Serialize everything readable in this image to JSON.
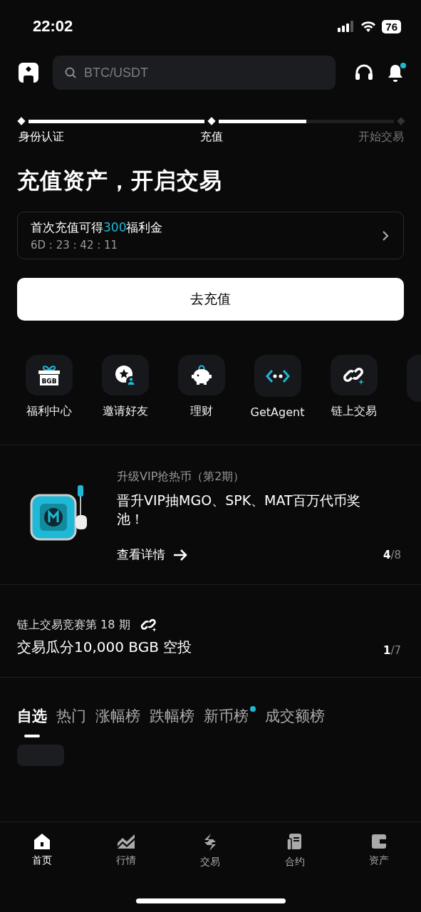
{
  "status_bar": {
    "time": "22:02",
    "battery": "76"
  },
  "header": {
    "search": {
      "placeholder": "BTC/USDT"
    },
    "notification_dot": true
  },
  "steps": [
    {
      "label": "身份认证",
      "reached": true
    },
    {
      "label": "充值",
      "reached": true
    },
    {
      "label": "开始交易",
      "reached": false
    }
  ],
  "step_segments": [
    {
      "level": 1
    },
    {
      "level": 0.5
    }
  ],
  "headline": "充值资产，开启交易",
  "promo": {
    "text_before": "首次充值可得",
    "amount": "300",
    "text_after": "福利金",
    "countdown": "6D : 23 : 42 : 11"
  },
  "deposit_button": "去充值",
  "shortcuts": [
    {
      "label": "福利中心",
      "kind": "gift",
      "badge": "BGB"
    },
    {
      "label": "邀请好友",
      "kind": "invite"
    },
    {
      "label": "理财",
      "kind": "piggy"
    },
    {
      "label": "GetAgent",
      "kind": "agent"
    },
    {
      "label": "链上交易",
      "kind": "chain"
    },
    {
      "kind": "more"
    }
  ],
  "banner": {
    "subtitle": "升级VIP抢热币（第2期）",
    "title": "晋升VIP抽MGO、SPK、MAT百万代币奖池！",
    "link": "查看详情",
    "page": "4",
    "total": "/8"
  },
  "contest": {
    "subtitle": "链上交易竞赛第 18 期",
    "title": "交易瓜分10,000 BGB 空投",
    "page": "1",
    "total": "/7"
  },
  "market_tabs": [
    {
      "label": "自选",
      "selected": true,
      "dot": false
    },
    {
      "label": "热门",
      "selected": false,
      "dot": false
    },
    {
      "label": "涨幅榜",
      "selected": false,
      "dot": false
    },
    {
      "label": "跌幅榜",
      "selected": false,
      "dot": false
    },
    {
      "label": "新币榜",
      "selected": false,
      "dot": true
    },
    {
      "label": "成交额榜",
      "selected": false,
      "dot": false
    }
  ],
  "bottom_nav": [
    {
      "label": "首页",
      "kind": "home",
      "selected": true
    },
    {
      "label": "行情",
      "kind": "chart",
      "selected": false
    },
    {
      "label": "交易",
      "kind": "swap",
      "selected": false
    },
    {
      "label": "合约",
      "kind": "contract",
      "selected": false
    },
    {
      "label": "资产",
      "kind": "wallet",
      "selected": false
    }
  ]
}
